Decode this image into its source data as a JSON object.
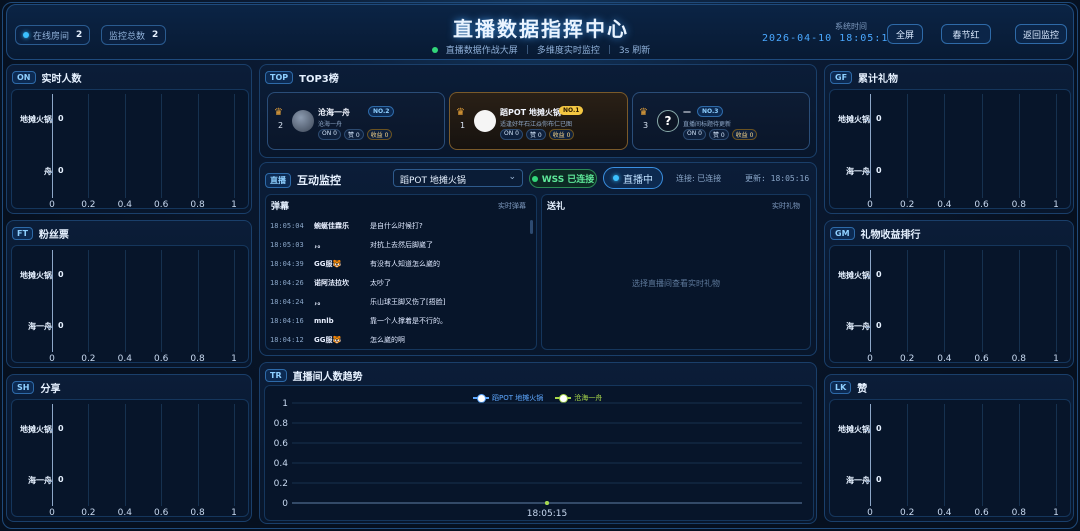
{
  "header": {
    "online_rooms_label": "在线房间",
    "online_rooms_value": "2",
    "monitor_total_label": "监控总数",
    "monitor_total_value": "2",
    "title": "直播数据指挥中心",
    "sub1": "直播数据作战大屏",
    "sub2": "多维度实时监控",
    "sub3": "3s 刷新",
    "systime_label": "系统时间",
    "systime": "2026-04-10 18:05:16",
    "btn_fullscreen": "全屏",
    "btn_theme": "春节红",
    "btn_back": "返回监控"
  },
  "panels": {
    "realtime": {
      "tag": "ON",
      "title": "实时人数"
    },
    "fans": {
      "tag": "FT",
      "title": "粉丝票"
    },
    "share": {
      "tag": "SH",
      "title": "分享"
    },
    "gifts_total": {
      "tag": "GF",
      "title": "累计礼物"
    },
    "gift_rank": {
      "tag": "GM",
      "title": "礼物收益排行"
    },
    "likes": {
      "tag": "LK",
      "title": "赞"
    },
    "top3": {
      "tag": "TOP",
      "title": "TOP3榜"
    },
    "monitor": {
      "tag": "直播",
      "title": "互动监控"
    },
    "trend": {
      "tag": "TR",
      "title": "直播间人数趋势"
    }
  },
  "bar_chart": {
    "rows": [
      "地摊火锅",
      "舟"
    ],
    "values": [
      0,
      0
    ],
    "xticks": [
      "0",
      "0.2",
      "0.4",
      "0.6",
      "0.8",
      "1"
    ]
  },
  "bar_chart_b": {
    "rows": [
      "地摊火锅",
      "海一舟"
    ],
    "values": [
      0,
      0
    ],
    "xticks": [
      "0",
      "0.2",
      "0.4",
      "0.6",
      "0.8",
      "1"
    ]
  },
  "top3": [
    {
      "rank": "2",
      "name": "沧海一舟",
      "badge": "NO.2",
      "sub": "沧海一舟",
      "on": "ON 0",
      "zan": "赞 0",
      "gift": "收益 0"
    },
    {
      "rank": "1",
      "name": "蹈POT 地摊火锅",
      "badge": "NO.1",
      "sub": "适逢好年石江焱你布仁已图",
      "on": "ON 0",
      "zan": "赞 0",
      "gift": "收益 0"
    },
    {
      "rank": "3",
      "name": "—",
      "badge": "NO.3",
      "avatar": "?",
      "sub": "直播间标题待更新",
      "on": "ON 0",
      "zan": "赞 0",
      "gift": "收益 0"
    }
  ],
  "monitor": {
    "selected_room": "蹈POT 地摊火锅",
    "wss": "WSS 已连接",
    "live": "直播中",
    "conn": "连接: 已连接",
    "updated": "更新: 18:05:16",
    "danmu_title": "弹幕",
    "danmu_tag": "实时弹幕",
    "gift_title": "送礼",
    "gift_tag": "实时礼物",
    "gift_empty": "选择直播间查看实时礼物",
    "messages": [
      {
        "t": "18:05:04",
        "u": "蜿蜒佳霖乐",
        "m": "是自什么时候打?"
      },
      {
        "t": "18:05:03",
        "u": "，。",
        "m": "对抗上去然后脚崴了"
      },
      {
        "t": "18:04:39",
        "u": "GG服🐯",
        "m": "有没有人知道怎么崴的"
      },
      {
        "t": "18:04:26",
        "u": "诺阿法拉坎",
        "m": "太吵了"
      },
      {
        "t": "18:04:24",
        "u": "，。",
        "m": "乐山球王脚又伤了[捂脸]"
      },
      {
        "t": "18:04:16",
        "u": "mnlb",
        "m": "靠一个人撑着是不行的。"
      },
      {
        "t": "18:04:12",
        "u": "GG服🐯",
        "m": "怎么崴的啊"
      }
    ]
  },
  "trend": {
    "series": [
      "蹈POT 地摊火锅",
      "沧海一舟"
    ],
    "yticks": [
      "1",
      "0.8",
      "0.6",
      "0.4",
      "0.2",
      "0"
    ],
    "xtick": "18:05:15"
  },
  "chart_data": [
    {
      "type": "bar",
      "title": "实时人数",
      "categories": [
        "地摊火锅",
        "舟"
      ],
      "values": [
        0,
        0
      ],
      "xlim": [
        0,
        1
      ]
    },
    {
      "type": "bar",
      "title": "粉丝票",
      "categories": [
        "地摊火锅",
        "海一舟"
      ],
      "values": [
        0,
        0
      ],
      "xlim": [
        0,
        1
      ]
    },
    {
      "type": "bar",
      "title": "分享",
      "categories": [
        "地摊火锅",
        "海一舟"
      ],
      "values": [
        0,
        0
      ],
      "xlim": [
        0,
        1
      ]
    },
    {
      "type": "bar",
      "title": "累计礼物",
      "categories": [
        "地摊火锅",
        "海一舟"
      ],
      "values": [
        0,
        0
      ],
      "xlim": [
        0,
        1
      ]
    },
    {
      "type": "bar",
      "title": "礼物收益排行",
      "categories": [
        "地摊火锅",
        "海一舟"
      ],
      "values": [
        0,
        0
      ],
      "xlim": [
        0,
        1
      ]
    },
    {
      "type": "bar",
      "title": "赞",
      "categories": [
        "地摊火锅",
        "海一舟"
      ],
      "values": [
        0,
        0
      ],
      "xlim": [
        0,
        1
      ]
    },
    {
      "type": "line",
      "title": "直播间人数趋势",
      "x": [
        "18:05:15"
      ],
      "series": [
        {
          "name": "蹈POT 地摊火锅",
          "values": [
            0
          ]
        },
        {
          "name": "沧海一舟",
          "values": [
            0
          ]
        }
      ],
      "ylim": [
        0,
        1
      ]
    }
  ]
}
